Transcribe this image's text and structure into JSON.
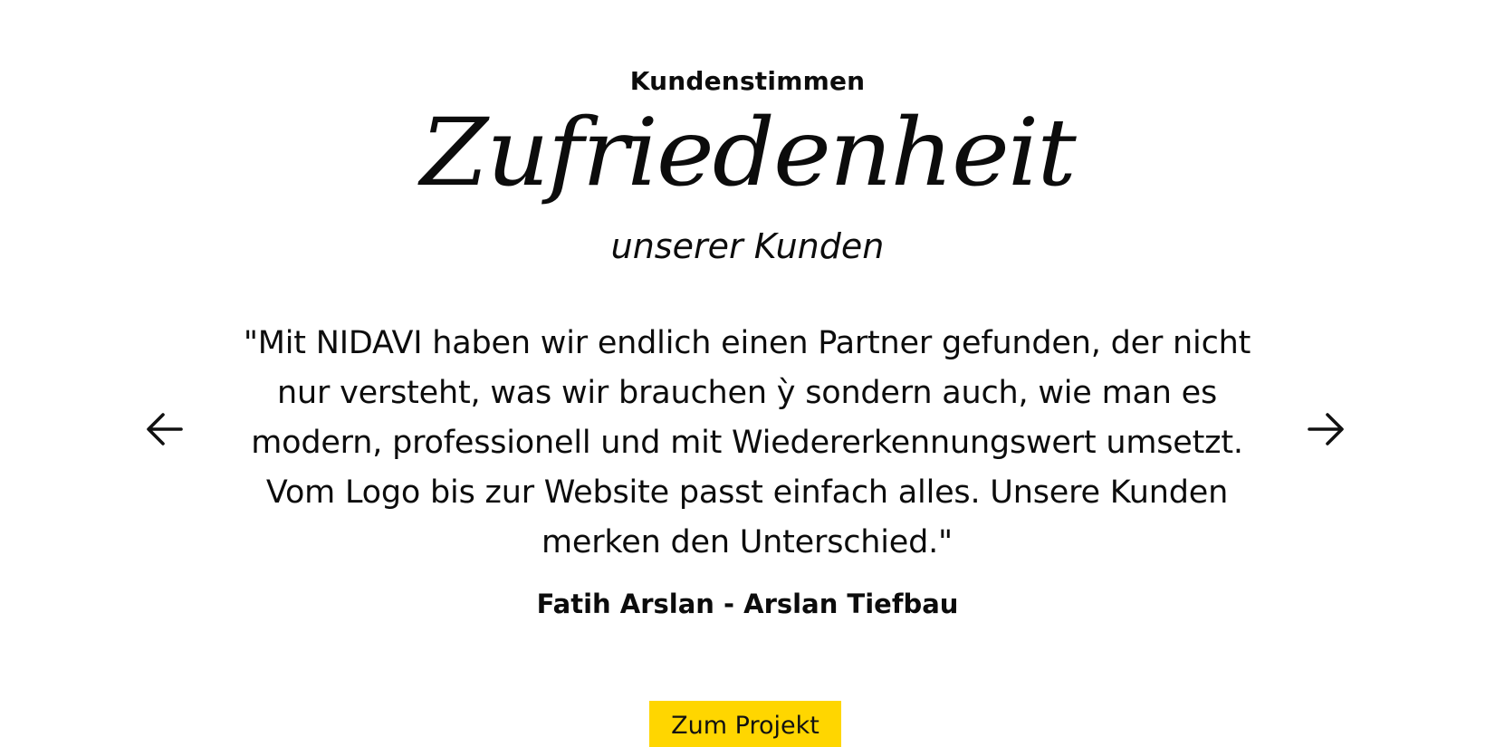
{
  "section": {
    "eyebrow": "Kundenstimmen",
    "headline": "Zufriedenheit",
    "subline": "unserer Kunden"
  },
  "testimonial": {
    "quote": "\"Mit NIDAVI haben wir endlich einen Partner gefunden, der nicht nur versteht, was wir brauchen ỳ sondern auch, wie man es modern, professionell und mit Wiedererkennungswert umsetzt. Vom Logo bis zur Website passt einfach alles. Unsere Kunden merken den Unterschied.\"",
    "author": "Fatih Arslan - Arslan Tiefbau"
  },
  "carousel": {
    "prev_icon": "arrow-left-icon",
    "next_icon": "arrow-right-icon"
  },
  "cta": {
    "label": "Zum Projekt",
    "color": "#ffd600"
  }
}
